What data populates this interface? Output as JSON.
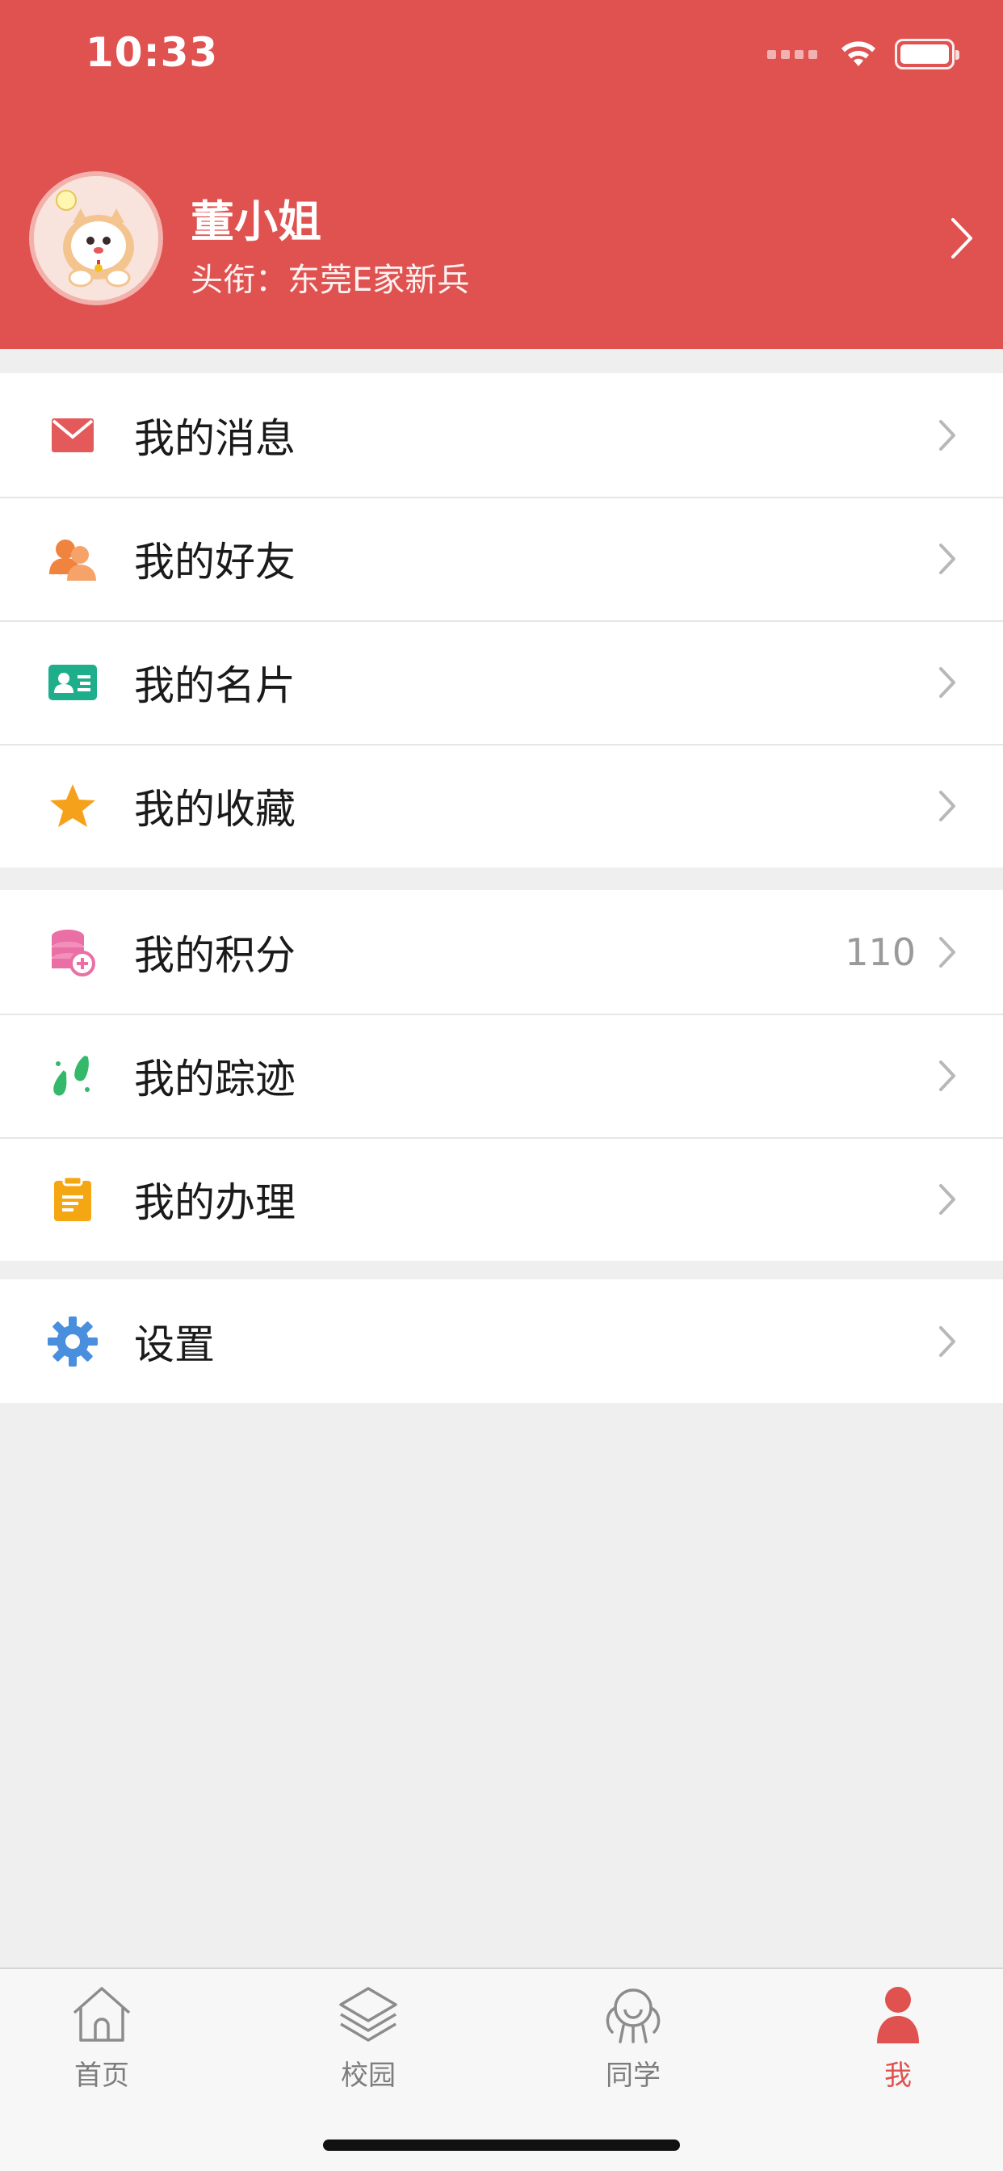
{
  "status_bar": {
    "time": "10:33"
  },
  "profile": {
    "name": "董小姐",
    "title": "头衔：东莞E家新兵"
  },
  "menu_groups": [
    {
      "items": [
        {
          "label": "我的消息",
          "icon": "envelope-icon",
          "color": "#e4595a"
        },
        {
          "label": "我的好友",
          "icon": "friends-icon",
          "color": "#f0833e"
        },
        {
          "label": "我的名片",
          "icon": "id-card-icon",
          "color": "#1fae8c"
        },
        {
          "label": "我的收藏",
          "icon": "star-icon",
          "color": "#f6a11b"
        }
      ]
    },
    {
      "items": [
        {
          "label": "我的积分",
          "value": "110",
          "icon": "coins-icon",
          "color": "#ea6fa5"
        },
        {
          "label": "我的踪迹",
          "icon": "footprints-icon",
          "color": "#34b86a"
        },
        {
          "label": "我的办理",
          "icon": "clipboard-icon",
          "color": "#f5a713"
        }
      ]
    },
    {
      "items": [
        {
          "label": "设置",
          "icon": "gear-icon",
          "color": "#4a8fdd"
        }
      ]
    }
  ],
  "tabbar": {
    "tabs": [
      {
        "label": "首页",
        "icon": "home-icon",
        "active": false
      },
      {
        "label": "校园",
        "icon": "layers-icon",
        "active": false
      },
      {
        "label": "同学",
        "icon": "classmates-icon",
        "active": false
      },
      {
        "label": "我",
        "icon": "person-icon",
        "active": true
      }
    ],
    "active_color": "#df5250"
  },
  "colors": {
    "brand": "#df5250",
    "background": "#efefef"
  }
}
